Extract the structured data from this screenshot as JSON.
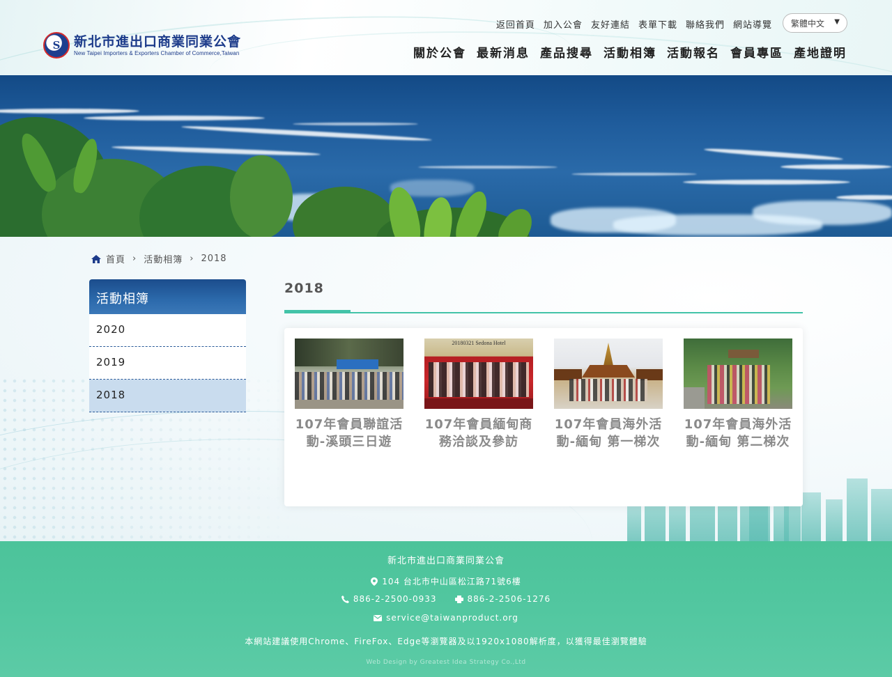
{
  "header": {
    "logo": {
      "emblem_text": "S",
      "name_cn": "新北市進出口商業同業公會",
      "name_en": "New Taipei Importers & Exporters Chamber of Commerce,Taiwan"
    },
    "top_links": [
      "返回首頁",
      "加入公會",
      "友好連結",
      "表單下載",
      "聯絡我們",
      "網站導覽"
    ],
    "language": {
      "selected": "繁體中文",
      "caret": "▼"
    },
    "main_menu": [
      "關於公會",
      "最新消息",
      "產品搜尋",
      "活動相簿",
      "活動報名",
      "會員專區",
      "產地證明"
    ]
  },
  "breadcrumb": {
    "home": "首頁",
    "section": "活動相簿",
    "current": "2018",
    "separator": "›"
  },
  "sidebar": {
    "title": "活動相簿",
    "items": [
      {
        "label": "2020"
      },
      {
        "label": "2019"
      },
      {
        "label": "2018",
        "active": true
      }
    ]
  },
  "main": {
    "title": "2018",
    "albums": [
      {
        "title": "107年會員聯誼活動-溪頭三日遊"
      },
      {
        "title": "107年會員緬甸商務洽談及參訪",
        "photo_caption": "20180321 Sedona Hotel"
      },
      {
        "title": "107年會員海外活動-緬甸 第一梯次"
      },
      {
        "title": "107年會員海外活動-緬甸 第二梯次"
      }
    ]
  },
  "footer": {
    "name": "新北市進出口商業同業公會",
    "address": "104 台北市中山區松江路71號6樓",
    "phone": "886-2-2500-0933",
    "fax": "886-2-2506-1276",
    "email": "service@taiwanproduct.org",
    "note": "本網站建議使用Chrome、FireFox、Edge等瀏覽器及以1920x1080解析度，以獲得最佳瀏覽體驗",
    "credit": "Web Design by Greatest Idea Strategy Co.,Ltd"
  },
  "colors": {
    "brand_blue": "#1c3b8a",
    "accent_green": "#43c3a8",
    "footer_green": "#52c7a0",
    "sidebar_active": "#c9dcee"
  }
}
